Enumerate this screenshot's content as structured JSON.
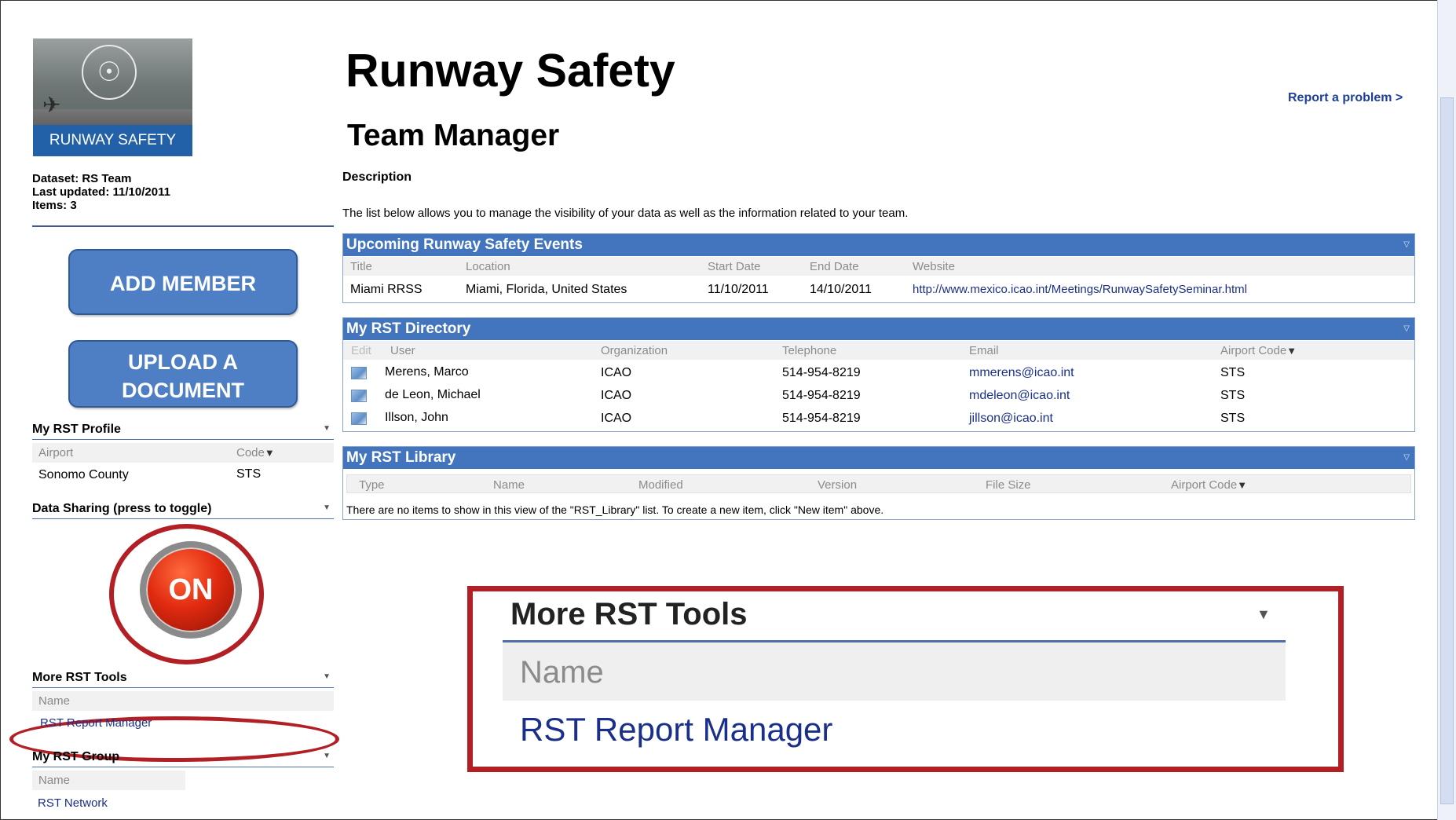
{
  "header": {
    "title": "Runway Safety",
    "subtitle": "Team Manager",
    "report_link": "Report a problem >",
    "description_label": "Description",
    "description_text": "The list below allows you to manage the visibility of your data as well as the information related to your team."
  },
  "logo": {
    "band_text": "RUNWAY SAFETY"
  },
  "dataset": {
    "line1": "Dataset: RS Team",
    "line2": "Last updated: 11/10/2011",
    "line3": "Items: 3"
  },
  "buttons": {
    "add_member": "ADD MEMBER",
    "upload_line1": "UPLOAD A",
    "upload_line2": "DOCUMENT"
  },
  "profile": {
    "heading": "My RST Profile",
    "col_airport": "Airport",
    "col_code": "Code",
    "airport": "Sonomo County",
    "code": "STS"
  },
  "sharing": {
    "heading": "Data Sharing (press to toggle)",
    "toggle_label": "ON"
  },
  "tools": {
    "heading": "More RST Tools",
    "col_name": "Name",
    "item": "RST Report Manager"
  },
  "group": {
    "heading": "My RST Group",
    "col_name": "Name",
    "item": "RST Network"
  },
  "events": {
    "title": "Upcoming Runway Safety Events",
    "columns": [
      "Title",
      "Location",
      "Start Date",
      "End Date",
      "Website"
    ],
    "rows": [
      [
        "Miami RRSS",
        "Miami, Florida, United States",
        "11/10/2011",
        "14/10/2011",
        "http://www.mexico.icao.int/Meetings/RunwaySafetySeminar.html"
      ]
    ]
  },
  "directory": {
    "title": "My RST Directory",
    "columns": [
      "Edit",
      "User",
      "Organization",
      "Telephone",
      "Email",
      "Airport Code"
    ],
    "rows": [
      [
        "Merens, Marco",
        "ICAO",
        "514-954-8219",
        "mmerens@icao.int",
        "STS"
      ],
      [
        "de Leon, Michael",
        "ICAO",
        "514-954-8219",
        "mdeleon@icao.int",
        "STS"
      ],
      [
        "Illson, John",
        "ICAO",
        "514-954-8219",
        "jillson@icao.int",
        "STS"
      ]
    ]
  },
  "library": {
    "title": "My RST Library",
    "columns": [
      "Type",
      "Name",
      "Modified",
      "Version",
      "File Size",
      "Airport Code"
    ],
    "empty_message": "There are no items to show in this view of the \"RST_Library\" list. To create a new item, click \"New item\" above."
  },
  "callout": {
    "heading": "More RST Tools",
    "col_name": "Name",
    "item": "RST Report Manager"
  },
  "icons": {
    "collapse": "dropdown-arrow-icon",
    "filter": "filter-icon",
    "edit": "edit-icon"
  },
  "colors": {
    "panel_header": "#4275bd",
    "button_blue": "#4e7fc4",
    "highlight_red": "#b21f24",
    "link": "#1a2f8a"
  }
}
